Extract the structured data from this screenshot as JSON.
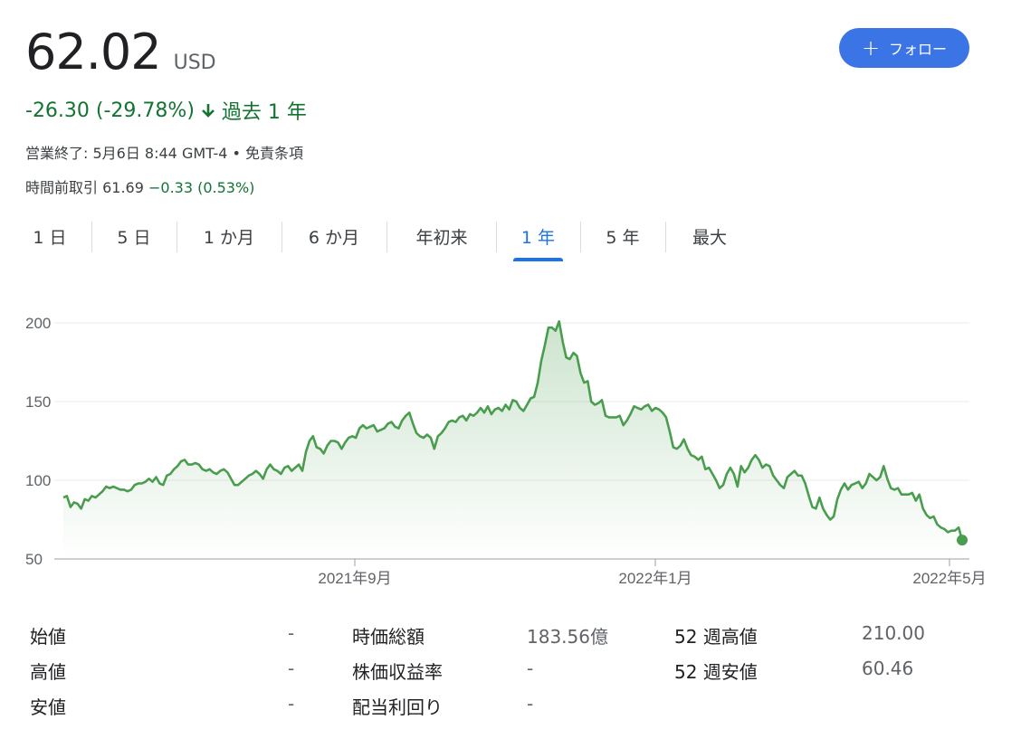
{
  "quote": {
    "price": "62.02",
    "currency": "USD",
    "change_text": "-26.30 (-29.78%)",
    "period_text": "過去 1 年",
    "status_text": "営業終了: 5月6日 8:44 GMT-4 • ",
    "disclaimer": "免責条項",
    "premarket_label": "時間前取引 61.69 ",
    "premarket_change": "−0.33 (0.53%)"
  },
  "follow_button": {
    "label": "フォロー",
    "icon": "plus-icon"
  },
  "tabs": [
    {
      "label": "1 日"
    },
    {
      "label": "5 日"
    },
    {
      "label": "1 か月"
    },
    {
      "label": "6 か月"
    },
    {
      "label": "年初来"
    },
    {
      "label": "1 年",
      "active": true
    },
    {
      "label": "5 年"
    },
    {
      "label": "最大"
    }
  ],
  "chart_data": {
    "type": "area",
    "y_ticks": [
      "200",
      "150",
      "100",
      "50"
    ],
    "x_ticks": [
      "2021年9月",
      "2022年1月",
      "2022年5月"
    ],
    "ylim": [
      50,
      200
    ],
    "grid": true,
    "color": "#4a9d4f",
    "values": [
      89,
      90,
      83,
      86,
      85,
      82,
      88,
      87,
      90,
      89,
      91,
      93,
      96,
      95,
      96,
      95,
      94,
      94,
      93,
      94,
      97,
      98,
      98,
      99,
      101,
      99,
      102,
      98,
      97,
      103,
      104,
      107,
      109,
      112,
      113,
      110,
      110,
      111,
      110,
      107,
      106,
      107,
      105,
      104,
      106,
      107,
      105,
      101,
      97,
      97,
      99,
      101,
      103,
      104,
      106,
      104,
      101,
      107,
      110,
      107,
      106,
      104,
      108,
      109,
      106,
      108,
      110,
      106,
      118,
      125,
      128,
      121,
      120,
      117,
      122,
      125,
      125,
      124,
      120,
      124,
      127,
      128,
      127,
      133,
      135,
      133,
      134,
      135,
      131,
      132,
      133,
      136,
      137,
      134,
      133,
      138,
      141,
      143,
      136,
      130,
      128,
      127,
      129,
      127,
      120,
      128,
      130,
      133,
      137,
      138,
      137,
      140,
      141,
      138,
      142,
      141,
      143,
      146,
      143,
      147,
      142,
      145,
      146,
      144,
      148,
      145,
      151,
      150,
      146,
      144,
      148,
      152,
      153,
      162,
      176,
      186,
      197,
      197,
      195,
      201,
      188,
      178,
      177,
      181,
      179,
      168,
      162,
      163,
      150,
      148,
      149,
      151,
      141,
      140,
      140,
      140,
      141,
      135,
      138,
      142,
      147,
      146,
      145,
      147,
      148,
      144,
      146,
      145,
      143,
      140,
      131,
      121,
      120,
      122,
      126,
      120,
      116,
      115,
      113,
      115,
      107,
      108,
      104,
      100,
      95,
      97,
      104,
      108,
      104,
      96,
      109,
      105,
      108,
      113,
      116,
      113,
      108,
      110,
      109,
      103,
      100,
      97,
      95,
      102,
      104,
      106,
      103,
      103,
      98,
      90,
      83,
      82,
      89,
      82,
      78,
      75,
      77,
      88,
      94,
      98,
      94,
      97,
      98,
      99,
      95,
      98,
      104,
      102,
      100,
      102,
      109,
      101,
      95,
      94,
      95,
      91,
      91,
      91,
      92,
      87,
      91,
      82,
      78,
      76,
      77,
      72,
      70,
      69,
      67,
      68,
      68,
      70,
      62
    ]
  },
  "stats": [
    {
      "label": "始値",
      "value": "-"
    },
    {
      "label": "高値",
      "value": "-"
    },
    {
      "label": "安値",
      "value": "-"
    },
    {
      "label": "時価総額",
      "value": "183.56億"
    },
    {
      "label": "株価収益率",
      "value": "-"
    },
    {
      "label": "配当利回り",
      "value": "-"
    },
    {
      "label": "52 週高値",
      "value": "210.00"
    },
    {
      "label": "52 週安値",
      "value": "60.46"
    }
  ]
}
